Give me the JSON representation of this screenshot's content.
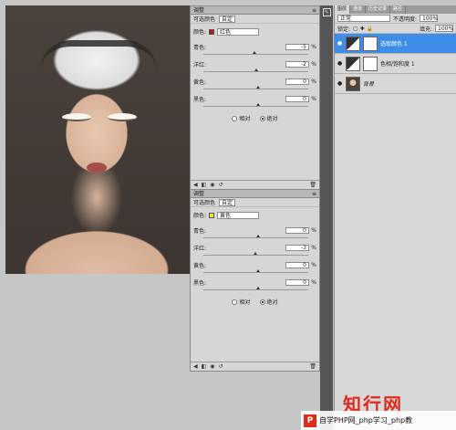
{
  "panel1": {
    "title": "调整",
    "preset_label": "可选颜色",
    "preset_value": "自定",
    "color_label": "颜色:",
    "color_value": "红色",
    "color_hex": "#cc1111",
    "rows": [
      {
        "label": "青色:",
        "value": "-5",
        "unit": "%",
        "level": 0.47
      },
      {
        "label": "洋红:",
        "value": "-2",
        "unit": "%",
        "level": 0.49
      },
      {
        "label": "黄色:",
        "value": "0",
        "unit": "%",
        "level": 0.5
      },
      {
        "label": "黑色:",
        "value": "0",
        "unit": "%",
        "level": 0.5
      }
    ],
    "radio_relative": "相对",
    "radio_absolute": "绝对",
    "selected_mode": "absolute"
  },
  "panel2": {
    "title": "调整",
    "preset_label": "可选颜色",
    "preset_value": "自定",
    "color_label": "颜色:",
    "color_value": "黄色",
    "color_hex": "#f3e33a",
    "rows": [
      {
        "label": "青色:",
        "value": "0",
        "unit": "%",
        "level": 0.5
      },
      {
        "label": "洋红:",
        "value": "-3",
        "unit": "%",
        "level": 0.48
      },
      {
        "label": "黄色:",
        "value": "0",
        "unit": "%",
        "level": 0.5
      },
      {
        "label": "黑色:",
        "value": "0",
        "unit": "%",
        "level": 0.5
      }
    ],
    "radio_relative": "相对",
    "radio_absolute": "绝对",
    "selected_mode": "absolute"
  },
  "layers": {
    "tabs": [
      "图层",
      "通道",
      "历史记录",
      "路径"
    ],
    "blend_mode": "正常",
    "opacity_label": "不透明度:",
    "opacity_value": "100%",
    "lock_label": "锁定:",
    "fill_label": "填充:",
    "fill_value": "100%",
    "items": [
      {
        "name": "选取颜色 1",
        "selected": true
      },
      {
        "name": "色相/饱和度 1",
        "selected": false
      },
      {
        "name": "背景",
        "selected": false
      }
    ]
  },
  "watermark": {
    "title": "知行网",
    "bar_text": "自学PHP网_php学习_php教",
    "logo_letter": "P"
  }
}
